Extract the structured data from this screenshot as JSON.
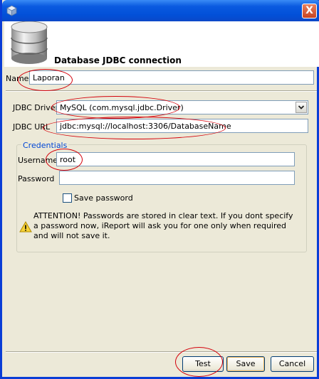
{
  "dialog": {
    "header_title": "Database JDBC connection",
    "close_glyph": "X"
  },
  "form": {
    "name_label": "Name",
    "name_value": "Laporan",
    "driver_label": "JDBC Driver",
    "driver_value": "MySQL (com.mysql.jdbc.Driver)",
    "url_label": "JDBC URL",
    "url_value": "jdbc:mysql://localhost:3306/DatabaseName"
  },
  "credentials": {
    "legend": "Credentials",
    "username_label": "Username",
    "username_value": "root",
    "password_label": "Password",
    "password_value": "",
    "save_password_label": "Save password",
    "save_password_checked": false,
    "warning_text": "ATTENTION! Passwords are stored in clear text. If you dont specify a password now, iReport will ask you for one only when required and will not save it."
  },
  "buttons": {
    "test": "Test",
    "save": "Save",
    "cancel": "Cancel"
  },
  "icons": {
    "app": "app-cube-icon",
    "header": "database-icon",
    "warning": "warning-icon",
    "dropdown": "chevron-down-icon"
  },
  "colors": {
    "titlebar": "#0a5ae0",
    "annotation": "#d4000a",
    "legend": "#0046d5",
    "dialog_bg": "#ece9d8"
  }
}
